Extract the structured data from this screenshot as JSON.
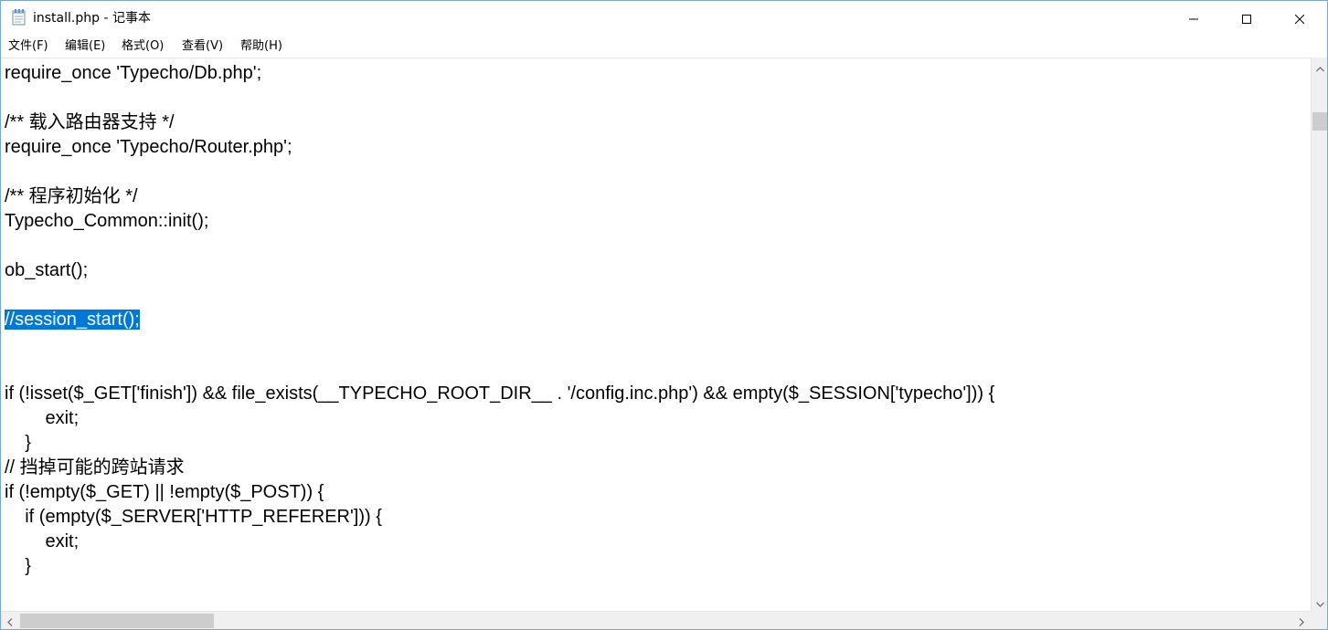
{
  "window": {
    "title": "install.php - 记事本",
    "icons": {
      "app": "notepad-icon",
      "minimize": "minimize-icon",
      "maximize": "maximize-icon",
      "close": "close-icon"
    }
  },
  "menu": {
    "items": [
      {
        "label": "文件(F)"
      },
      {
        "label": "编辑(E)"
      },
      {
        "label": "格式(O)"
      },
      {
        "label": "查看(V)"
      },
      {
        "label": "帮助(H)"
      }
    ]
  },
  "editor": {
    "lines": [
      "require_once 'Typecho/Db.php';",
      "",
      "/** 载入路由器支持 */",
      "require_once 'Typecho/Router.php';",
      "",
      "/** 程序初始化 */",
      "Typecho_Common::init();",
      "",
      "ob_start();",
      "",
      "//session_start();",
      "",
      "",
      "if (!isset($_GET['finish']) && file_exists(__TYPECHO_ROOT_DIR__ . '/config.inc.php') && empty($_SESSION['typecho'])) {",
      "        exit;",
      "    }",
      "// 挡掉可能的跨站请求",
      "if (!empty($_GET) || !empty($_POST)) {",
      "    if (empty($_SERVER['HTTP_REFERER'])) {",
      "        exit;",
      "    }"
    ],
    "selected_line_index": 10,
    "selection_color": "#0078d7"
  },
  "scrollbars": {
    "icons": {
      "up": "scroll-up-arrow-icon",
      "down": "scroll-down-arrow-icon",
      "left": "scroll-left-arrow-icon",
      "right": "scroll-right-arrow-icon"
    }
  }
}
